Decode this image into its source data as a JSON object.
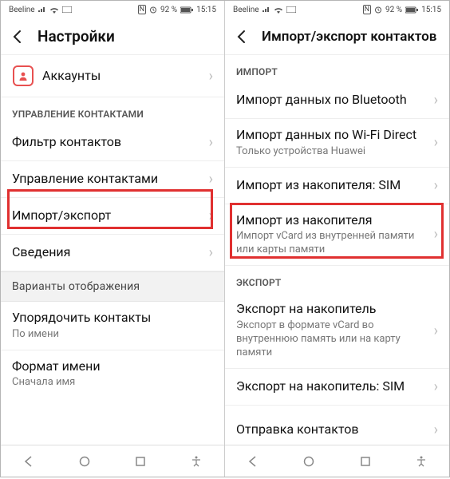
{
  "status": {
    "carrier": "Beeline",
    "nfc": "N",
    "battery": "92 %",
    "time": "15:15"
  },
  "left": {
    "title": "Настройки",
    "accounts": "Аккаунты",
    "section_manage": "УПРАВЛЕНИЕ КОНТАКТАМИ",
    "filter": "Фильтр контактов",
    "manage": "Управление контактами",
    "import_export": "Импорт/экспорт",
    "info": "Сведения",
    "section_display": "Варианты отображения",
    "sort": "Упорядочить контакты",
    "sort_sub": "По имени",
    "name_format": "Формат имени",
    "name_format_sub": "Сначала имя"
  },
  "right": {
    "title": "Импорт/экспорт контактов",
    "section_import": "ИМПОРТ",
    "bt": "Импорт данных по Bluetooth",
    "wifi": "Импорт данных по Wi-Fi Direct",
    "wifi_sub": "Только устройства Huawei",
    "sim_import": "Импорт из накопителя: SIM",
    "storage": "Импорт из накопителя",
    "storage_sub": "Импорт vCard из внутренней памяти или карты памяти",
    "section_export": "ЭКСПОРТ",
    "export_storage": "Экспорт на накопитель",
    "export_storage_sub": "Экспорт в формате vCard во внутреннюю память или на карту памяти",
    "sim_export": "Экспорт на накопитель: SIM",
    "share": "Отправка контактов"
  }
}
